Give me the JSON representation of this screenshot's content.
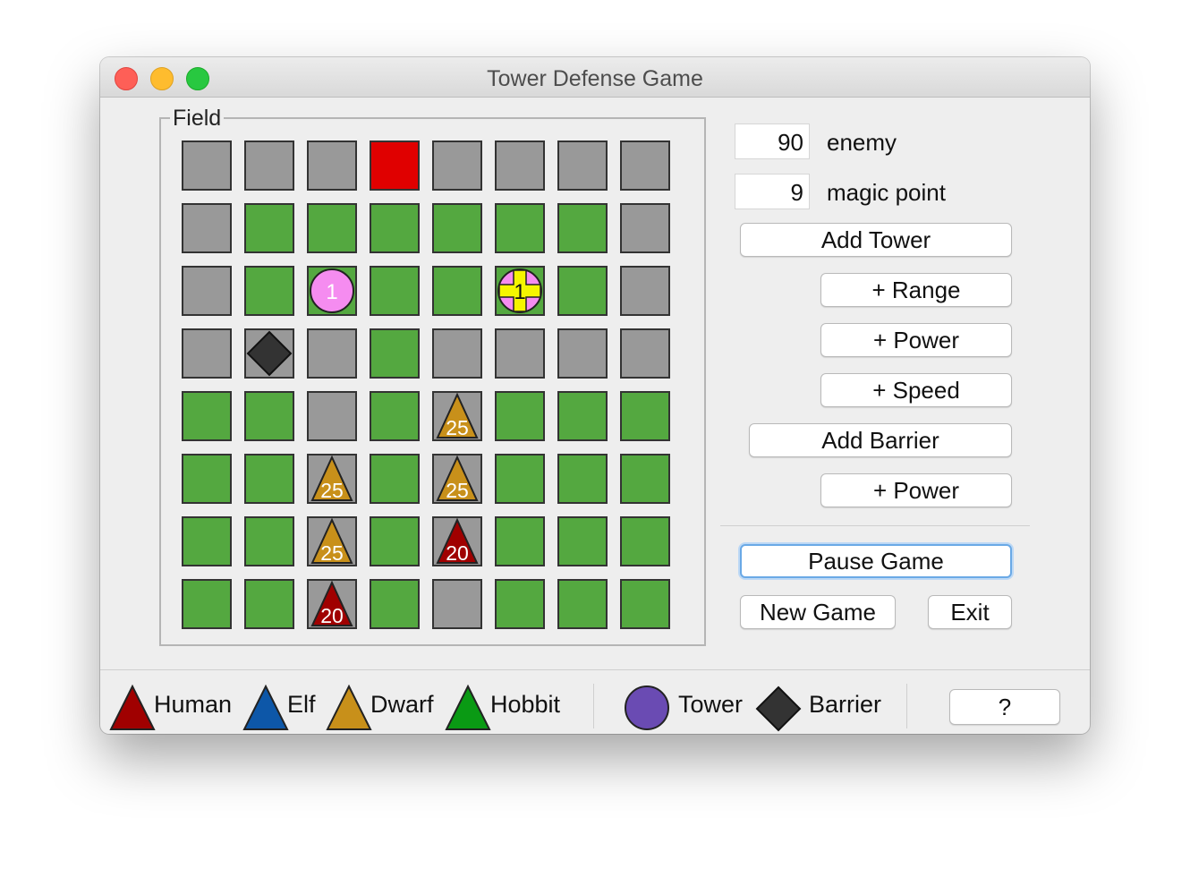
{
  "window": {
    "title": "Tower Defense Game"
  },
  "field": {
    "label": "Field",
    "rows": [
      [
        "gray",
        "gray",
        "gray",
        "red",
        "gray",
        "gray",
        "gray",
        "gray"
      ],
      [
        "gray",
        "green",
        "green",
        "green",
        "green",
        "green",
        "green",
        "gray"
      ],
      [
        "gray",
        "green",
        "green",
        "green",
        "green",
        "green",
        "green",
        "gray"
      ],
      [
        "gray",
        "gray",
        "gray",
        "green",
        "gray",
        "gray",
        "gray",
        "gray"
      ],
      [
        "green",
        "green",
        "gray",
        "green",
        "gray",
        "green",
        "green",
        "green"
      ],
      [
        "green",
        "green",
        "gray",
        "green",
        "gray",
        "green",
        "green",
        "green"
      ],
      [
        "green",
        "green",
        "gray",
        "green",
        "gray",
        "green",
        "green",
        "green"
      ],
      [
        "green",
        "green",
        "gray",
        "green",
        "gray",
        "green",
        "green",
        "green"
      ]
    ],
    "objects": [
      {
        "kind": "tower",
        "row": 2,
        "col": 2,
        "label": "1",
        "fill": "#f58cf0"
      },
      {
        "kind": "tower-upgraded",
        "row": 2,
        "col": 5,
        "label": "1",
        "fill": "#f58cf0",
        "cross": "#f5f500"
      },
      {
        "kind": "barrier",
        "row": 3,
        "col": 1,
        "fill": "#333333"
      },
      {
        "kind": "enemy",
        "race": "dwarf",
        "row": 4,
        "col": 4,
        "label": "25",
        "fill": "#c8901a"
      },
      {
        "kind": "enemy",
        "race": "dwarf",
        "row": 5,
        "col": 2,
        "label": "25",
        "fill": "#c8901a"
      },
      {
        "kind": "enemy",
        "race": "dwarf",
        "row": 5,
        "col": 4,
        "label": "25",
        "fill": "#c8901a"
      },
      {
        "kind": "enemy",
        "race": "dwarf",
        "row": 6,
        "col": 2,
        "label": "25",
        "fill": "#c8901a"
      },
      {
        "kind": "enemy",
        "race": "human",
        "row": 6,
        "col": 4,
        "label": "20",
        "fill": "#a00000"
      },
      {
        "kind": "enemy",
        "race": "human",
        "row": 7,
        "col": 2,
        "label": "20",
        "fill": "#a00000"
      }
    ]
  },
  "stats": {
    "enemy_value": "90",
    "enemy_label": "enemy",
    "magic_value": "9",
    "magic_label": "magic point"
  },
  "buttons": {
    "add_tower": "Add Tower",
    "range": "+ Range",
    "tower_power": "+ Power",
    "speed": "+ Speed",
    "add_barrier": "Add Barrier",
    "barrier_power": "+ Power",
    "pause": "Pause Game",
    "new_game": "New Game",
    "exit": "Exit",
    "help": "?"
  },
  "legend": {
    "human": {
      "label": "Human",
      "color": "#a00000"
    },
    "elf": {
      "label": "Elf",
      "color": "#0d57a8"
    },
    "dwarf": {
      "label": "Dwarf",
      "color": "#c8901a"
    },
    "hobbit": {
      "label": "Hobbit",
      "color": "#0a9a14"
    },
    "tower": {
      "label": "Tower",
      "color": "#6a4bb3"
    },
    "barrier": {
      "label": "Barrier",
      "color": "#333333"
    }
  }
}
